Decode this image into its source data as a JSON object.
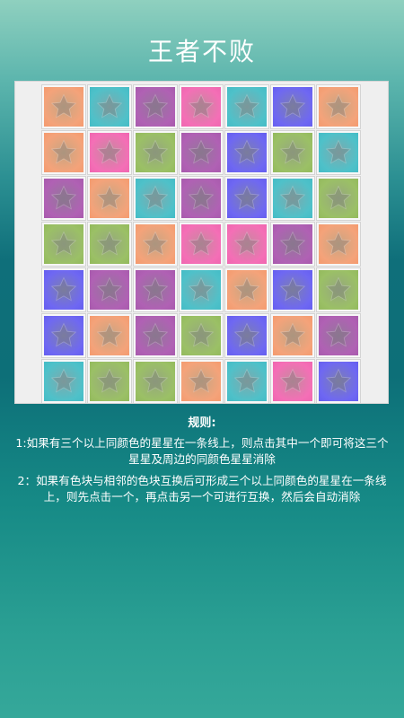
{
  "title": "王者不败",
  "colors": {
    "orange": "#f4a37a",
    "teal": "#4fc1c9",
    "purple": "#b061b4",
    "pink": "#f46fb6",
    "blue": "#6f68f2",
    "green": "#9bc066",
    "board_bg": "#efefef"
  },
  "tile_icon": "star-icon",
  "board": {
    "rows": [
      [
        "orange",
        "teal",
        "purple",
        "pink",
        "teal",
        "blue",
        "orange"
      ],
      [
        "orange",
        "pink",
        "green",
        "purple",
        "blue",
        "green",
        "teal"
      ],
      [
        "purple",
        "orange",
        "teal",
        "purple",
        "blue",
        "teal",
        "green"
      ],
      [
        "green",
        "green",
        "orange",
        "pink",
        "pink",
        "purple",
        "orange"
      ],
      [
        "blue",
        "purple",
        "purple",
        "teal",
        "orange",
        "blue",
        "green"
      ],
      [
        "blue",
        "orange",
        "purple",
        "green",
        "blue",
        "orange",
        "purple"
      ],
      [
        "teal",
        "green",
        "green",
        "orange",
        "teal",
        "pink",
        "blue"
      ]
    ]
  },
  "rules": {
    "heading": "规则:",
    "items": [
      "1:如果有三个以上同颜色的星星在一条线上，则点击其中一个即可将这三个星星及周边的同颜色星星消除",
      "2：如果有色块与相邻的色块互换后可形成三个以上同颜色的星星在一条线上，则先点击一个，再点击另一个可进行互换，然后会自动消除"
    ]
  }
}
